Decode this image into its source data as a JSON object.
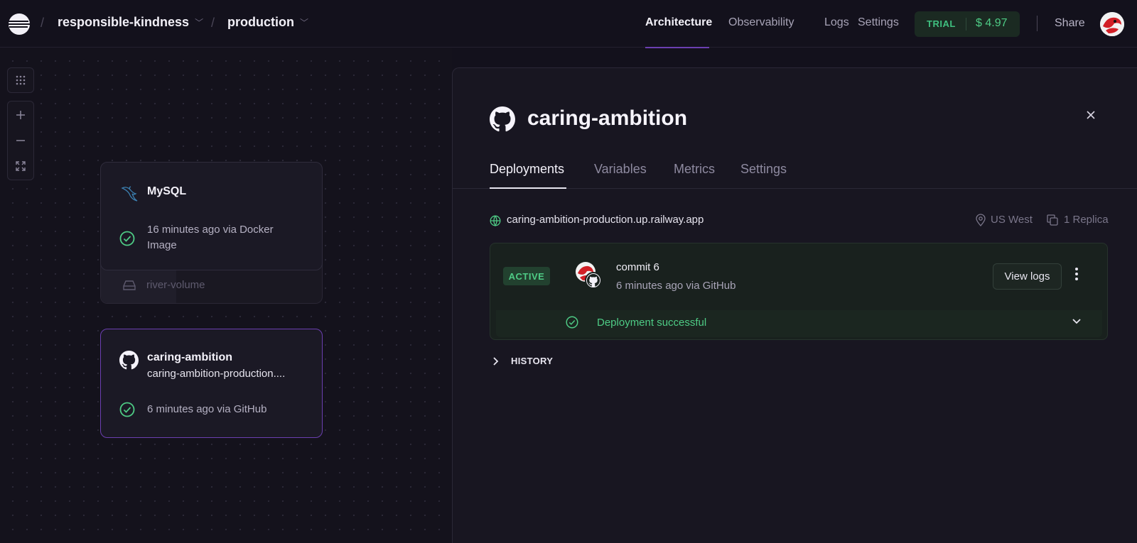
{
  "topbar": {
    "project": "responsible-kindness",
    "environment": "production",
    "nav": [
      "Architecture",
      "Observability",
      "Logs",
      "Settings"
    ],
    "trial_label": "TRIAL",
    "trial_amount": "$ 4.97",
    "share": "Share"
  },
  "canvas": {
    "services": [
      {
        "name": "MySQL",
        "status": "16 minutes ago via Docker Image",
        "volume": "river-volume"
      },
      {
        "name": "caring-ambition",
        "url": "caring-ambition-production....",
        "status": "6 minutes ago via GitHub"
      }
    ]
  },
  "panel": {
    "title": "caring-ambition",
    "tabs": [
      "Deployments",
      "Variables",
      "Metrics",
      "Settings"
    ],
    "url": "caring-ambition-production.up.railway.app",
    "region": "US West",
    "replicas": "1 Replica",
    "deployment": {
      "badge": "ACTIVE",
      "commit": "commit 6",
      "meta": "6 minutes ago via GitHub",
      "view_logs": "View logs",
      "status": "Deployment successful"
    },
    "history": "HISTORY"
  },
  "colors": {
    "accent_green": "#4ecb85",
    "selected_border": "#6b3fb0",
    "background": "#13111c"
  }
}
